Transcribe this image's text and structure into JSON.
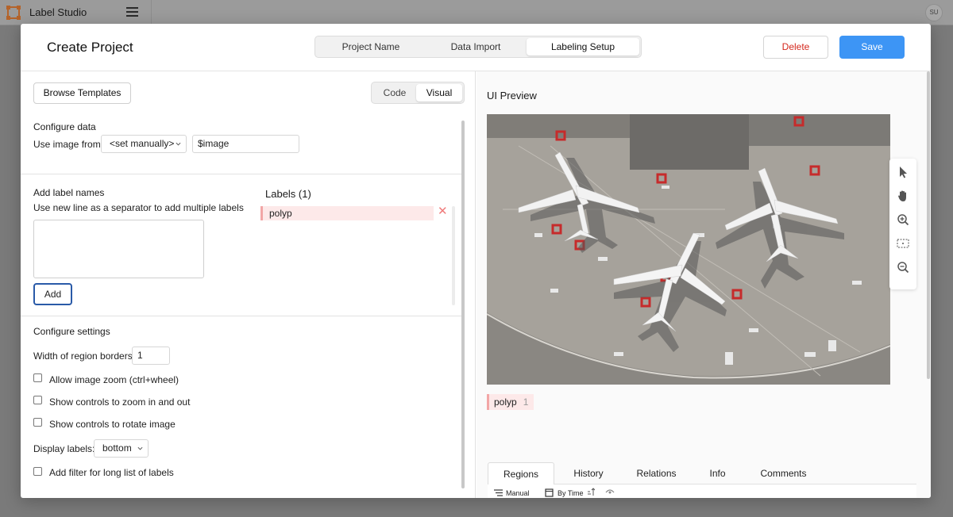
{
  "app": {
    "title": "Label Studio",
    "user_initials": "SU"
  },
  "modal": {
    "title": "Create Project",
    "steps": [
      "Project Name",
      "Data Import",
      "Labeling Setup"
    ],
    "active_step": 2,
    "delete_label": "Delete",
    "save_label": "Save"
  },
  "config": {
    "browse_templates": "Browse Templates",
    "mode_options": [
      "Code",
      "Visual"
    ],
    "active_mode": "Visual",
    "configure_data": {
      "title": "Configure data",
      "use_image_label": "Use image from",
      "source_value": "<set manually>",
      "variable_value": "$image"
    },
    "label_names": {
      "title": "Add label names",
      "hint": "Use new line as a separator to add multiple labels",
      "add_label": "Add",
      "labels_title": "Labels (1)",
      "labels": [
        "polyp"
      ]
    },
    "settings": {
      "title": "Configure settings",
      "region_border_label": "Width of region borders",
      "region_border_value": "1",
      "allow_zoom": "Allow image zoom (ctrl+wheel)",
      "show_zoom_controls": "Show controls to zoom in and out",
      "show_rotate_controls": "Show controls to rotate image",
      "display_labels_label": "Display labels:",
      "display_labels_value": "bottom",
      "add_filter": "Add filter for long list of labels"
    }
  },
  "preview": {
    "title": "UI Preview",
    "region_label": "polyp",
    "region_count": "1",
    "tabs": [
      "Regions",
      "History",
      "Relations",
      "Info",
      "Comments"
    ],
    "active_tab": "Regions",
    "sub_items": [
      "Manual",
      "By Time"
    ]
  },
  "colors": {
    "accent": "#3d95f5",
    "delete": "#d4281d",
    "label_bg": "#fde9e9",
    "label_border": "#f2a6a6"
  }
}
